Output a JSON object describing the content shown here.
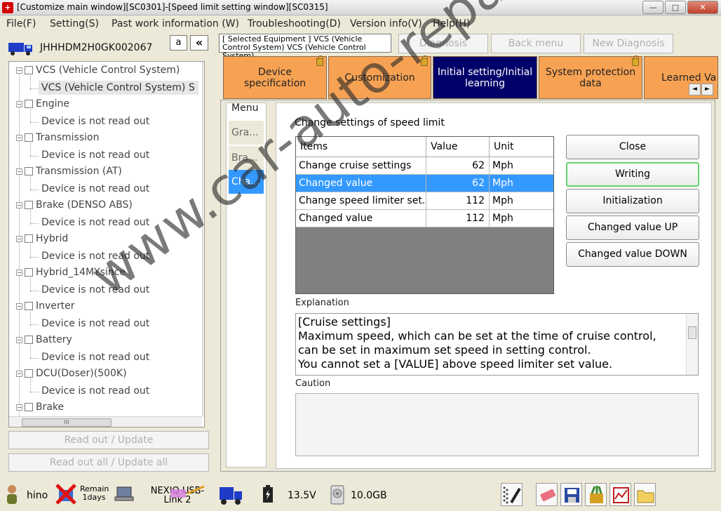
{
  "window": {
    "title": "[Customize main window][SC0301]-[Speed limit setting window][SC0315]",
    "app_icon": "+",
    "min_label": "—",
    "max_label": "□",
    "close_label": "✕"
  },
  "menubar": {
    "items": [
      "File(F)",
      "Setting(S)",
      "Past work information (W)",
      "Troubleshooting(D)",
      "Version info(V)",
      "Help(H)"
    ]
  },
  "left": {
    "vin": "JHHHDM2H0GK002067",
    "a_label": "a",
    "collapse_label": "«",
    "tree": [
      {
        "label": "VCS (Vehicle Control System)",
        "child": "VCS (Vehicle Control System) S"
      },
      {
        "label": "Engine",
        "child": "Device is not read out"
      },
      {
        "label": "Transmission",
        "child": "Device is not read out"
      },
      {
        "label": "Transmission (AT)",
        "child": "Device is not read out"
      },
      {
        "label": "Brake (DENSO ABS)",
        "child": "Device is not read out"
      },
      {
        "label": "Hybrid",
        "child": "Device is not read out"
      },
      {
        "label": "Hybrid_14MYsince",
        "child": "Device is not read out"
      },
      {
        "label": "Inverter",
        "child": "Device is not read out"
      },
      {
        "label": "Battery",
        "child": "Device is not read out"
      },
      {
        "label": "DCU(Doser)(500K)",
        "child": "Device is not read out"
      },
      {
        "label": "Brake",
        "child": ""
      }
    ],
    "hscroll_grip": "III",
    "read_out_update": "Read out / Update",
    "read_out_all_update": "Read out all / Update all"
  },
  "top": {
    "selected_equipment": "[ Selected Equipment ] VCS (Vehicle Control System) VCS (Vehicle Control System)",
    "diagnosis": "Diagnosis",
    "back_menu": "Back menu",
    "new_diagnosis": "New Diagnosis"
  },
  "tabs": [
    {
      "label": "Device specification",
      "locked": true
    },
    {
      "label": "Customization",
      "locked": true
    },
    {
      "label": "Initial setting/Initial learning",
      "locked": false,
      "active": true
    },
    {
      "label": "System protection data",
      "locked": true
    },
    {
      "label": "Learned Va",
      "locked": false
    }
  ],
  "tab_scroll": {
    "left": "◄",
    "right": "►"
  },
  "side_menu": {
    "label": "Menu",
    "items": [
      "Gra...",
      "Bra...",
      "Cha..."
    ]
  },
  "panel": {
    "heading": "Change settings of speed limit",
    "columns": [
      "Items",
      "Value",
      "Unit"
    ],
    "rows": [
      {
        "item": "Change cruise settings",
        "value": "62",
        "unit": "Mph"
      },
      {
        "item": "Changed value",
        "value": "62",
        "unit": "Mph"
      },
      {
        "item": "Change speed limiter set...",
        "value": "112",
        "unit": "Mph"
      },
      {
        "item": "Changed value",
        "value": "112",
        "unit": "Mph"
      }
    ],
    "selected_row": 1,
    "buttons": {
      "close": "Close",
      "writing": "Writing",
      "initialization": "Initialization",
      "up": "Changed value UP",
      "down": "Changed value DOWN"
    },
    "explanation_label": "Explanation",
    "explanation_lines": [
      "[Cruise settings]",
      "Maximum speed, which can be set at the time of cruise control,",
      "can be set in maximum set speed in setting control.",
      "You cannot set a [VALUE] above speed limiter set value."
    ],
    "caution_label": "Caution"
  },
  "statusbar": {
    "user": "hino",
    "remain_line1": "Remain",
    "remain_line2": "1days",
    "nexiq_line1": "NEXIQ USB-",
    "nexiq_line2": "Link 2",
    "voltage": "13.5V",
    "disk": "10.0GB"
  },
  "watermark": "www.car-auto-repair.com",
  "colors": {
    "tab_orange": "#f7a253",
    "tab_active": "#00006a",
    "selection": "#3399ff",
    "writing_border": "#67d36f"
  }
}
